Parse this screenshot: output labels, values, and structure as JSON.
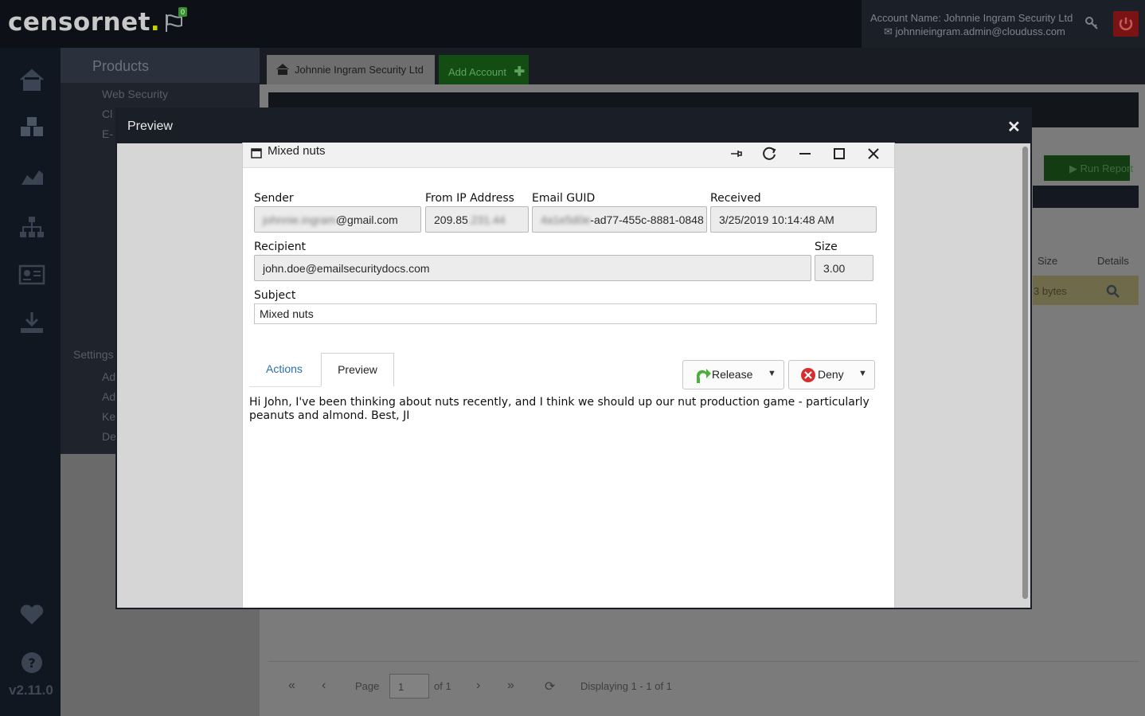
{
  "app": {
    "logo_text": "censornet",
    "logo_dot": ".",
    "notification_count": "0",
    "version": "v2.11.0",
    "account_name": "Account Name: Johnnie Ingram Security Ltd",
    "account_email": "johnnieingram.admin@clouduss.com",
    "accent_color": "#c8d400"
  },
  "menu": {
    "header": "Products",
    "items": [
      "Web Security",
      "Cl",
      "E-"
    ],
    "settings_label": "Settings",
    "sub_items": [
      "Ad",
      "Ad",
      "Ke",
      "De"
    ]
  },
  "tabs": {
    "home_label": "Johnnie Ingram Security Ltd",
    "add_label": "Add Account"
  },
  "report": {
    "run_report_label": "Run Report",
    "col_size": "Size",
    "col_details": "Details",
    "row_size": "3 bytes"
  },
  "pager": {
    "page_label": "Page",
    "page_value": "1",
    "of_label": "of 1",
    "displaying": "Displaying 1 - 1 of 1"
  },
  "modal": {
    "title": "Preview"
  },
  "window": {
    "title": "Mixed nuts",
    "sender_label": "Sender",
    "sender_masked": "johnnie.ingram",
    "sender_domain": "@gmail.com",
    "ip_label": "From IP Address",
    "ip_visible": "209.85",
    "ip_masked": ".231.44",
    "guid_label": "Email GUID",
    "guid_masked": "4a1e5d0e",
    "guid_visible": "-ad77-455c-8881-0848",
    "received_label": "Received",
    "received_value": "3/25/2019 10:14:48 AM",
    "recipient_label": "Recipient",
    "recipient_value": "john.doe@emailsecuritydocs.com",
    "size_label": "Size",
    "size_value": "3.00",
    "subject_label": "Subject",
    "subject_value": "Mixed nuts",
    "tab_actions": "Actions",
    "tab_preview": "Preview",
    "release_label": "Release",
    "deny_label": "Deny",
    "body": "Hi John, I've been thinking about nuts recently, and I think we should up our nut production game - particularly peanuts and almond. Best, JI"
  }
}
